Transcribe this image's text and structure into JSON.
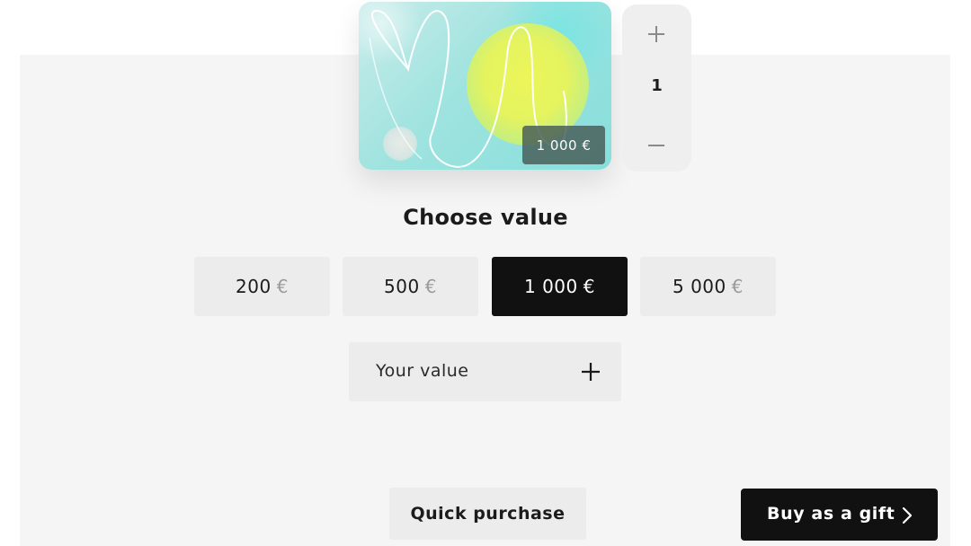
{
  "card": {
    "price_label": "1 000 €"
  },
  "stepper": {
    "count": "1",
    "plus_icon": "plus-icon",
    "minus_icon": "minus-icon"
  },
  "heading": "Choose value",
  "values": [
    {
      "amount": "200",
      "currency": "€",
      "selected": false
    },
    {
      "amount": "500",
      "currency": "€",
      "selected": false
    },
    {
      "amount": "1 000",
      "currency": "€",
      "selected": true
    },
    {
      "amount": "5 000",
      "currency": "€",
      "selected": false
    }
  ],
  "custom_value": {
    "label": "Your value",
    "icon": "plus-icon"
  },
  "actions": {
    "quick_purchase": "Quick purchase",
    "buy_gift": "Buy as a gift",
    "buy_gift_icon": "chevron-right-icon"
  },
  "colors": {
    "selected_bg": "#111111",
    "option_bg": "#ececec",
    "panel_bg": "#f5f5f5",
    "card_yellow": "#e4f35f",
    "card_teal": "#86dfdc"
  }
}
